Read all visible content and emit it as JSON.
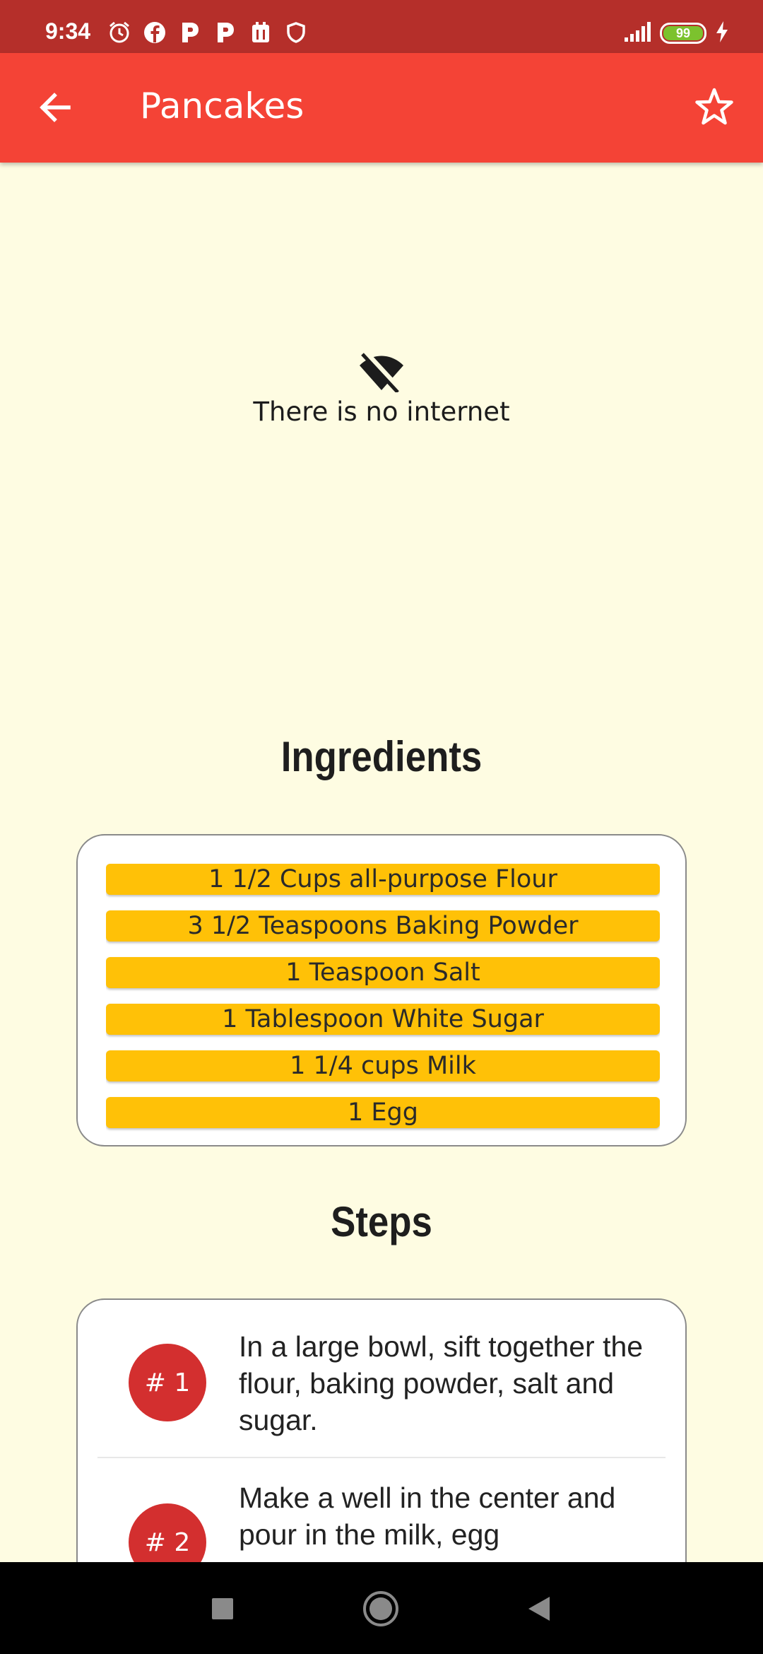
{
  "status_bar": {
    "time": "9:34",
    "battery": "99",
    "left_icons": [
      "alarm-icon",
      "facebook-icon",
      "p-app-icon",
      "p-app-icon",
      "calendar-icon",
      "shield-icon"
    ],
    "right_icons": [
      "signal-icon",
      "battery-icon",
      "charging-icon"
    ]
  },
  "app_bar": {
    "title": "Pancakes",
    "background": "#f44336",
    "back_icon": "arrow-back-icon",
    "favorite_icon": "star-outline-icon"
  },
  "connectivity": {
    "icon": "wifi-off-icon",
    "message": "There is no internet"
  },
  "ingredients": {
    "heading": "Ingredients",
    "items": [
      "1 1/2 Cups all-purpose Flour",
      "3 1/2 Teaspoons Baking Powder",
      "1 Teaspoon Salt",
      "1 Tablespoon White Sugar",
      "1 1/4 cups Milk",
      "1 Egg"
    ],
    "item_color": "#ffc107"
  },
  "steps": {
    "heading": "Steps",
    "items": [
      {
        "number": "# 1",
        "text": "In a large bowl, sift together the flour, baking powder, salt and sugar."
      },
      {
        "number": "# 2",
        "text": "Make a well in the center and pour in the milk, egg"
      }
    ],
    "badge_color": "#d32f2f"
  },
  "nav_bar": {
    "icons": [
      "recents-square-icon",
      "home-circle-icon",
      "back-triangle-icon"
    ]
  }
}
